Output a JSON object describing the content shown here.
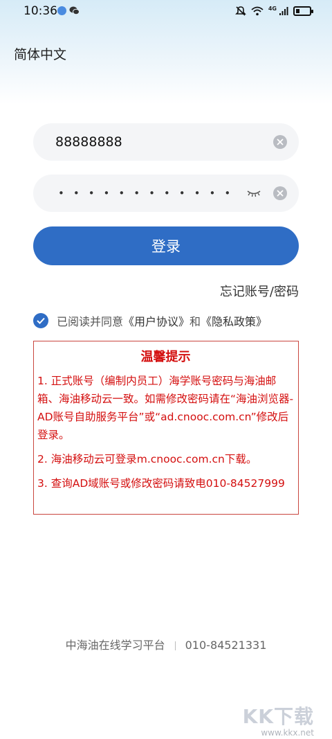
{
  "status_bar": {
    "time": "10:36",
    "network_label": "4G"
  },
  "language": "简体中文",
  "login": {
    "username_value": "88888888",
    "password_mask": "••••••••••••",
    "login_button": "登录",
    "forgot_link": "忘记账号/密码"
  },
  "agreement": {
    "prefix": "已阅读并同意",
    "user_agreement": "《用户协议》",
    "conjunction": "和",
    "privacy_policy": "《隐私政策》",
    "checked": true
  },
  "notice": {
    "title": "温馨提示",
    "items": [
      "1. 正式账号（编制内员工）海学账号密码与海油邮箱、海油移动云一致。如需修改密码请在“海油浏览器-AD账号自助服务平台”或“ad.cnooc.com.cn”修改后登录。",
      "2. 海油移动云可登录m.cnooc.com.cn下载。",
      "3. 查询AD域账号或修改密码请致电010-84527999"
    ]
  },
  "footer": {
    "platform": "中海油在线学习平台",
    "phone": "010-84521331"
  },
  "watermark": {
    "logo": "KK下载",
    "url": "www.kkx.net"
  },
  "colors": {
    "primary": "#2f6dc5",
    "notice_red": "#d40f0f",
    "field_bg": "#f4f5f7"
  }
}
